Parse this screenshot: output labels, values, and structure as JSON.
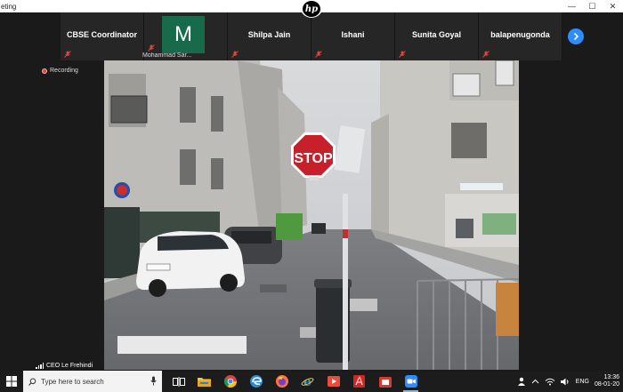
{
  "window": {
    "title": "eting",
    "minimize_glyph": "—",
    "maximize_glyph": "☐",
    "close_glyph": "✕"
  },
  "brand": {
    "hp_logo_text": "hp"
  },
  "participants": [
    {
      "name": "CBSE Coordinator",
      "muted": true
    },
    {
      "name": "Mohammad Sar...",
      "initial": "M",
      "avatar_color": "#176b4b",
      "muted": true
    },
    {
      "name": "Shilpa Jain",
      "muted": true
    },
    {
      "name": "Ishani",
      "muted": true
    },
    {
      "name": "Sunita Goyal",
      "muted": true
    },
    {
      "name": "balapenugonda",
      "muted": true
    }
  ],
  "recording": {
    "label": "Recording",
    "color": "#e0453a"
  },
  "main_video": {
    "sign_text": "STOP",
    "speaker": "CEO Le Frehindi"
  },
  "taskbar": {
    "search_placeholder": "Type here to search",
    "apps": [
      "task-view",
      "file-explorer",
      "chrome",
      "edge",
      "firefox",
      "internet-explorer",
      "remote-app",
      "acrobat",
      "files-app",
      "zoom"
    ],
    "tray": {
      "language": "ENG",
      "time": "13:36",
      "date": "08-01-20"
    }
  },
  "colors": {
    "accent": "#2d8cff",
    "taskbar": "#1c1c1c",
    "tile": "#262626"
  }
}
